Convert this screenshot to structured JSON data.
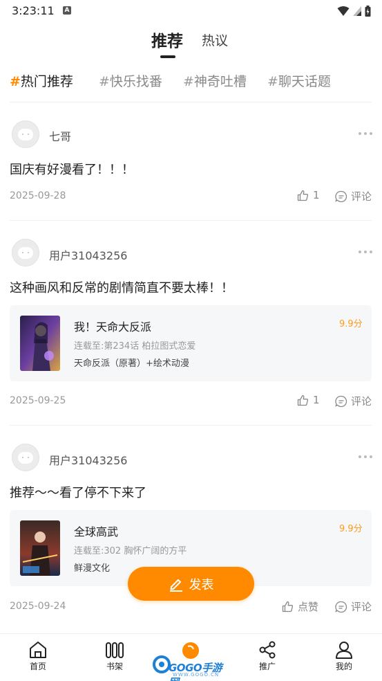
{
  "status_bar": {
    "time": "3:23:11",
    "notif_letter": "A"
  },
  "header": {
    "tabs": [
      "推荐",
      "热议"
    ]
  },
  "topics": [
    {
      "hash": "#",
      "label": "热门推荐"
    },
    {
      "hash": "#",
      "label": "快乐找番"
    },
    {
      "hash": "#",
      "label": "神奇吐槽"
    },
    {
      "hash": "#",
      "label": "聊天话题"
    }
  ],
  "posts": [
    {
      "username": "七哥",
      "content": "国庆有好漫看了！！！",
      "date": "2025-09-28",
      "likes": "1",
      "comment_label": "评论"
    },
    {
      "username": "用户31043256",
      "content": "这种画风和反常的剧情简直不要太棒！！",
      "book": {
        "title": "我！天命大反派",
        "progress": "连载至:第234话 柏拉图式恋爱",
        "author": "天命反派（原著）+绘术动漫",
        "score": "9.9分"
      },
      "date": "2025-09-25",
      "likes": "1",
      "comment_label": "评论"
    },
    {
      "username": "用户31043256",
      "content": "推荐～～看了停不下来了",
      "book": {
        "title": "全球高武",
        "progress": "连载至:302 胸怀广阔的方平",
        "author": "鲜漫文化",
        "score": "9.9分"
      },
      "date": "2025-09-24",
      "likes": "点赞",
      "comment_label": "评论"
    }
  ],
  "publish_label": "发表",
  "bottom_nav": [
    {
      "label": "首页",
      "icon": "home-icon"
    },
    {
      "label": "书架",
      "icon": "bookshelf-icon"
    },
    {
      "label": "推广",
      "icon": "share-icon"
    },
    {
      "label": "我的",
      "icon": "profile-icon"
    }
  ],
  "watermark": {
    "text": "GOGO手游网",
    "sub": "WWW.GOGO.CN"
  },
  "colors": {
    "accent": "#ff8a00",
    "score": "#ff9a1a",
    "card_bg": "#f6f7f9"
  }
}
